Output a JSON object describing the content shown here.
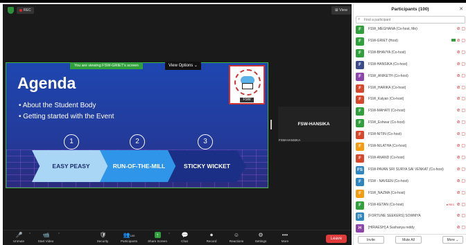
{
  "colors": {
    "green": "#2fa03b",
    "leave": "#e03a3a",
    "slide_blue": "#1e46b0"
  },
  "meeting": {
    "rec_label": "REC",
    "view_label": "View",
    "share_banner": "You are viewing FSW-GRIET's screen",
    "view_options": "View Options ⌄"
  },
  "slide": {
    "title": "Agenda",
    "bullets": [
      "• About the Student Body",
      "• Getting started with the Event"
    ],
    "numbers": [
      "1",
      "2",
      "3"
    ],
    "steps": [
      "EASY PEASY",
      "RUN-OF-THE-MILL",
      "STICKY WICKET"
    ],
    "logo_label": "FSW"
  },
  "video": {
    "name": "FSW-HANSIKA",
    "sub": "FSW-HANSIKA"
  },
  "toolbar": {
    "items": [
      {
        "label": "Unmute",
        "icon": "🎤"
      },
      {
        "label": "Start Video",
        "icon": "📹"
      },
      {
        "label": "Security",
        "icon": "🛡"
      },
      {
        "label": "Participants",
        "icon": "👥"
      },
      {
        "label": "Share Screen",
        "icon": "↑"
      },
      {
        "label": "Chat",
        "icon": "💬"
      },
      {
        "label": "Record",
        "icon": "⏺"
      },
      {
        "label": "Reactions",
        "icon": "☺"
      },
      {
        "label": "Settings",
        "icon": "⚙"
      },
      {
        "label": "More",
        "icon": "•••"
      }
    ],
    "participants_count": "100",
    "leave": "Leave"
  },
  "panel": {
    "title": "Participants (100)",
    "search_placeholder": "Find a participant",
    "participants": [
      {
        "initial": "F",
        "name": "FSW_MEGHANA (Co-host, Me)",
        "color": "#2fa03b"
      },
      {
        "initial": "F",
        "name": "FSW-GRIET (Host)",
        "color": "#2fa03b"
      },
      {
        "initial": "F",
        "name": "FSW-BHAVYA (Co-host)",
        "color": "#2fa03b"
      },
      {
        "initial": "F",
        "name": "FSW-HANSIKA (Co-host)",
        "color": "#3a4a8c"
      },
      {
        "initial": "F",
        "name": "FSW_ANIKETH (Co-host)",
        "color": "#8e44ad"
      },
      {
        "initial": "F",
        "name": "FSW_HARIKA (Co-host)",
        "color": "#d9472b"
      },
      {
        "initial": "F",
        "name": "FSW_Kalyan (Co-host)",
        "color": "#d9472b"
      },
      {
        "initial": "F",
        "name": "FSW-MAHATI (Co-host)",
        "color": "#2fa03b"
      },
      {
        "initial": "F",
        "name": "FSW_Eshwar (Co-host)",
        "color": "#2fa03b"
      },
      {
        "initial": "F",
        "name": "FSW-NITIN (Co-host)",
        "color": "#d9472b"
      },
      {
        "initial": "F",
        "name": "FSW-NILATHA (Co-host)",
        "color": "#f39c12"
      },
      {
        "initial": "F",
        "name": "FSW-ANAND (Co-host)",
        "color": "#d9472b"
      },
      {
        "initial": "FS",
        "name": "FSW-PAVAN SRI SURYA SAI VENKAT (Co-host)",
        "color": "#2e86c1"
      },
      {
        "initial": "F",
        "name": "FSW - NAVEEN (Co-host)",
        "color": "#2e86c1"
      },
      {
        "initial": "F",
        "name": "FSW_NAZMA (Co-host)",
        "color": "#f39c12"
      },
      {
        "initial": "F",
        "name": "FSW-KETAN (Co-host)",
        "color": "#2fa03b"
      },
      {
        "initial": "[S",
        "name": "[FORTUNE SEEKERS] SOWMYA",
        "color": "#2e86c1"
      },
      {
        "initial": "H",
        "name": "[HIRAESH] A Sushanya reddy",
        "color": "#8e44ad"
      }
    ],
    "invite": "Invite",
    "mute_all": "Mute All",
    "more": "More ⌄"
  }
}
